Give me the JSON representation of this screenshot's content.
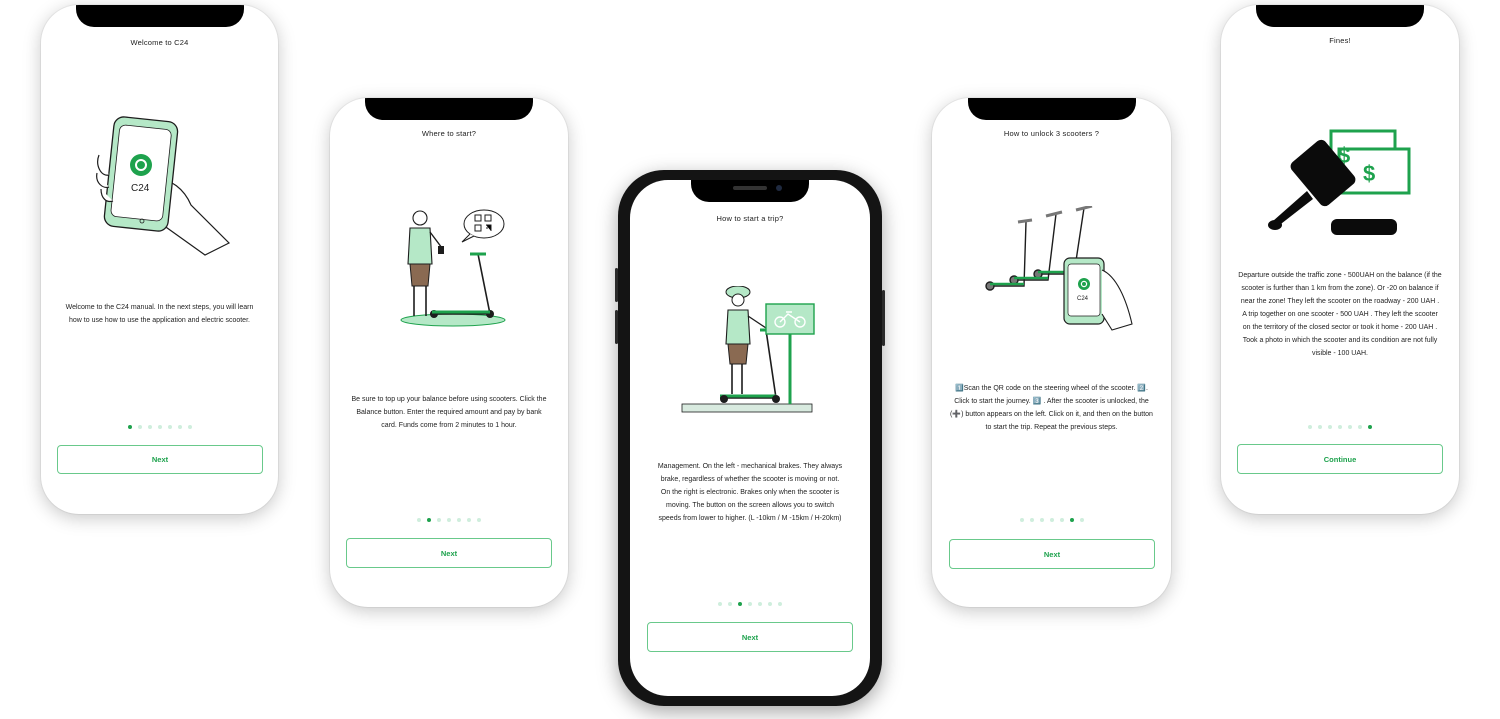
{
  "screens": [
    {
      "title": "Welcome to C24",
      "body": "Welcome to the C24 manual. In the next steps, you will learn how to use how to use the application and electric scooter.",
      "logo_text": "C24",
      "dots_total": 7,
      "active_dot": 0,
      "button": "Next"
    },
    {
      "title": "Where to start?",
      "body": "Be sure to top up your balance before using scooters. Click the Balance button. Enter the required amount and pay by bank card. Funds come from 2 minutes to 1 hour.",
      "dots_total": 7,
      "active_dot": 1,
      "button": "Next"
    },
    {
      "title": "How to start a trip?",
      "body": "Management. On the left - mechanical brakes. They always brake, regardless of whether the scooter is moving or not. On the right is electronic. Brakes only when the scooter is moving. The button on the screen allows you to switch speeds from lower to higher. (L -10km / M -15km / H-20km)",
      "dots_total": 7,
      "active_dot": 2,
      "button": "Next"
    },
    {
      "title": "How to unlock 3 scooters ?",
      "body": "1️⃣Scan the QR code on the steering wheel of the scooter. 2️⃣. Click to start the journey. 3️⃣ . After the scooter is unlocked, the (➕) button appears on the left. Click on it, and then on the button to start the trip. Repeat the previous steps.",
      "logo_text": "C24",
      "dots_total": 7,
      "active_dot": 5,
      "button": "Next"
    },
    {
      "title": "Fines!",
      "body": "Departure outside the traffic zone - 500UAH on the balance (if the scooter is further than 1 km from the zone). Or -20 on balance if near the zone! They left the scooter on the roadway - 200 UAH . A trip together on one scooter - 500 UAH . They left the scooter on the territory of the closed sector or took it home - 200 UAH . Took a photo in which the scooter and its condition are not fully visible - 100 UAH.",
      "dots_total": 7,
      "active_dot": 6,
      "button": "Continue"
    }
  ],
  "colors": {
    "accent": "#1ea24d",
    "accent_light": "#b5e8c7",
    "dot_inactive": "#cfeedd"
  },
  "icons": [
    "phone-in-hand-icon",
    "man-with-scooter-icon",
    "qr-speech-bubble-icon",
    "rider-on-scooter-icon",
    "bike-sign-icon",
    "three-scooters-icon",
    "gavel-icon",
    "money-bills-icon"
  ]
}
